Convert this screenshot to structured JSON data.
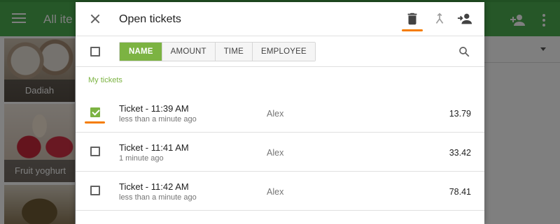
{
  "background_app": {
    "title": "All ite",
    "tiles": [
      {
        "label": "Dadiah"
      },
      {
        "label": "Fruit yoghurt"
      },
      {
        "label": ""
      }
    ]
  },
  "dialog": {
    "title": "Open tickets",
    "header_icons": [
      "close-icon",
      "trash-icon",
      "merge-icon",
      "person-add-icon"
    ],
    "sort_options": [
      {
        "label": "NAME",
        "active": true
      },
      {
        "label": "AMOUNT",
        "active": false
      },
      {
        "label": "TIME",
        "active": false
      },
      {
        "label": "EMPLOYEE",
        "active": false
      }
    ],
    "section_label": "My tickets",
    "tickets": [
      {
        "name": "Ticket - 11:39 AM",
        "age": "less than a minute ago",
        "employee": "Alex",
        "amount": "13.79",
        "checked": true
      },
      {
        "name": "Ticket - 11:41 AM",
        "age": "1 minute  ago",
        "employee": "Alex",
        "amount": "33.42",
        "checked": false
      },
      {
        "name": "Ticket - 11:42 AM",
        "age": "less than a minute ago",
        "employee": "Alex",
        "amount": "78.41",
        "checked": false
      }
    ]
  },
  "colors": {
    "accent_green": "#7cb342",
    "highlight_orange": "#f57c00",
    "app_bar_green": "#4caf50"
  }
}
